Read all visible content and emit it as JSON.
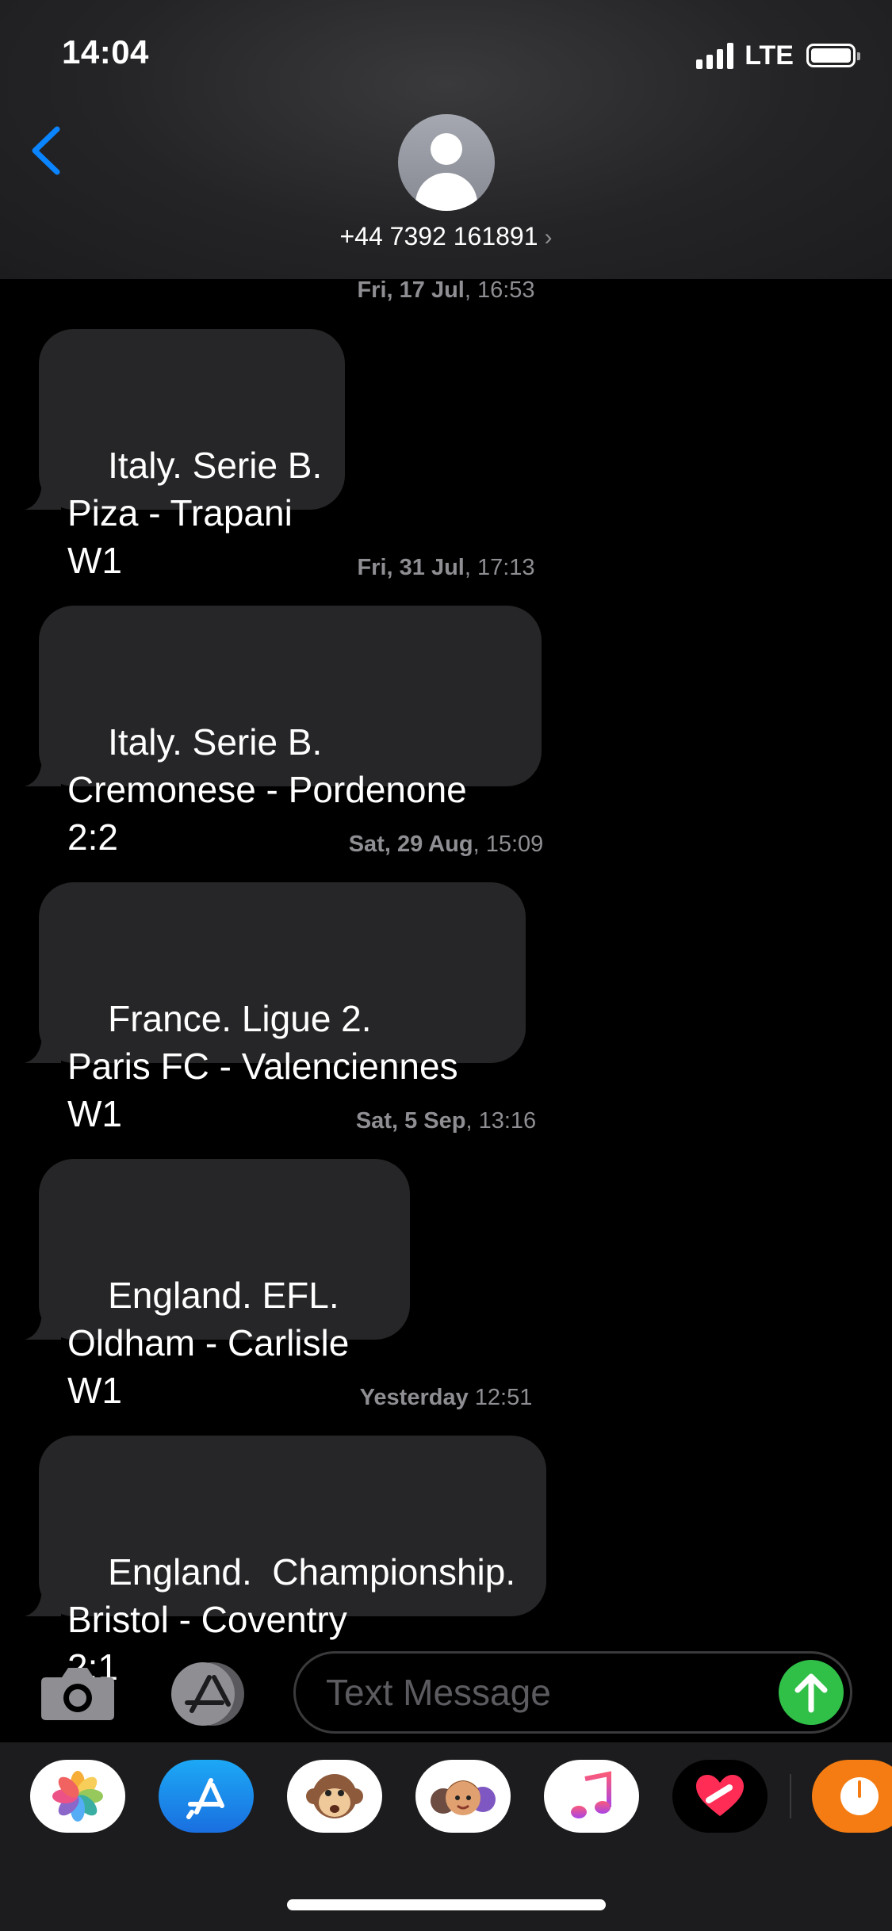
{
  "status_bar": {
    "time": "14:04",
    "network": "LTE"
  },
  "header": {
    "contact_number": "+44 7392 161891",
    "chevron": "›"
  },
  "messages": [
    {
      "date_bold": "Fri, 17 Jul",
      "time": ", 16:53",
      "text": "Italy. Serie B.\nPiza - Trapani\nW1"
    },
    {
      "date_bold": "Fri, 31 Jul",
      "time": ", 17:13",
      "text": "Italy. Serie B.\nCremonese - Pordenone\n2:2"
    },
    {
      "date_bold": "Sat, 29 Aug",
      "time": ", 15:09",
      "text": "France. Ligue 2.\nParis FC - Valenciennes\nW1"
    },
    {
      "date_bold": "Sat, 5 Sep",
      "time": ", 13:16",
      "text": "England. EFL.\nOldham - Carlisle\nW1"
    },
    {
      "date_bold": "Yesterday",
      "time": " 12:51",
      "text": "England.  Championship.\nBristol - Coventry\n2:1"
    }
  ],
  "input": {
    "placeholder": "Text Message"
  },
  "app_drawer": {
    "apps": [
      "photos-icon",
      "app-store-icon",
      "animoji-icon",
      "memoji-icon",
      "music-icon",
      "digital-touch-icon",
      "scale-icon"
    ]
  },
  "colors": {
    "bubble": "#262628",
    "accent_blue": "#0a84ff",
    "send_green": "#30c048",
    "timestamp": "#8e8e93"
  }
}
